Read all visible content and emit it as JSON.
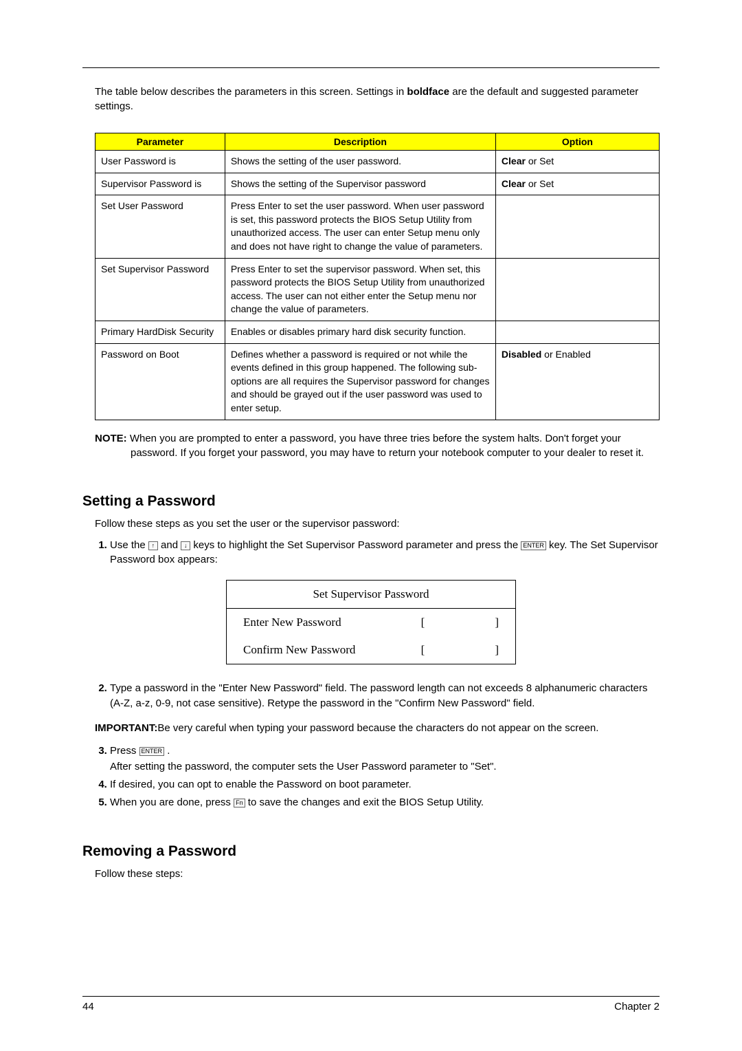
{
  "intro": {
    "prefix": "The table below describes the parameters in this screen. Settings in ",
    "bold": "boldface",
    "suffix": " are the default and suggested parameter settings."
  },
  "table": {
    "headers": {
      "param": "Parameter",
      "desc": "Description",
      "opt": "Option"
    },
    "rows": [
      {
        "param": "User Password is",
        "desc": "Shows the setting of the user password.",
        "opt_bold": "Clear",
        "opt_rest": " or Set"
      },
      {
        "param": "Supervisor Password is",
        "desc": "Shows the setting of the Supervisor password",
        "opt_bold": "Clear",
        "opt_rest": " or Set"
      },
      {
        "param": "Set User Password",
        "desc": "Press Enter to set the user password. When user password is set, this password protects the BIOS Setup Utility from unauthorized access. The user can enter Setup menu only and does not have right to change the value of parameters.",
        "opt_bold": "",
        "opt_rest": ""
      },
      {
        "param": "Set Supervisor Password",
        "desc": "Press Enter to set the supervisor password. When set, this password protects the BIOS Setup Utility from unauthorized access. The user can not either enter the Setup menu nor change the value of parameters.",
        "opt_bold": "",
        "opt_rest": ""
      },
      {
        "param": "Primary HardDisk Security",
        "desc": "Enables or disables primary hard disk security function.",
        "opt_bold": "",
        "opt_rest": ""
      },
      {
        "param": "Password on Boot",
        "desc": "Defines whether a password is required or not while the events defined in this group happened. The following sub-options are all requires the Supervisor password for changes and should be grayed out if the user password was used to enter setup.",
        "opt_bold": "Disabled",
        "opt_rest": " or Enabled"
      }
    ]
  },
  "note": {
    "label": "NOTE: ",
    "text": "When you are prompted to enter a password, you have three tries before the system halts. Don't forget your password. If you forget your password, you may have to return your notebook computer to your dealer to reset it."
  },
  "sections": {
    "setting": {
      "heading": "Setting a Password",
      "intro": "Follow these steps as you set the user or the supervisor password:"
    },
    "removing": {
      "heading": "Removing a Password",
      "intro": "Follow these steps:"
    }
  },
  "steps": {
    "s1a": "Use the ",
    "s1b": " and ",
    "s1c": " keys to highlight the Set Supervisor Password parameter and press the ",
    "s1d": " key. The Set Supervisor Password box appears:",
    "key_up": "↑",
    "key_down": "↓",
    "key_enter": "ENTER",
    "key_fn": "Fn",
    "s2": "Type a password in the \"Enter New Password\" field. The password length can not exceeds 8 alphanumeric characters (A-Z, a-z, 0-9, not case sensitive). Retype the password in the \"Confirm New Password\" field.",
    "s3a": "Press ",
    "s3b": " .",
    "s3c": "After setting the password, the computer sets the User Password parameter to \"Set\".",
    "s4": "If desired, you can opt to enable the Password on boot parameter.",
    "s5a": "When you are done, press ",
    "s5b": " to save the changes and exit the BIOS Setup Utility."
  },
  "dialog": {
    "title": "Set Supervisor Password",
    "enter": "Enter New Password",
    "confirm": "Confirm New Password",
    "bracket_open": "[",
    "bracket_close": "]"
  },
  "important": {
    "label": "IMPORTANT:",
    "text": "Be very careful when typing your password because the characters do not appear on the screen."
  },
  "footer": {
    "page": "44",
    "chapter": "Chapter 2"
  }
}
